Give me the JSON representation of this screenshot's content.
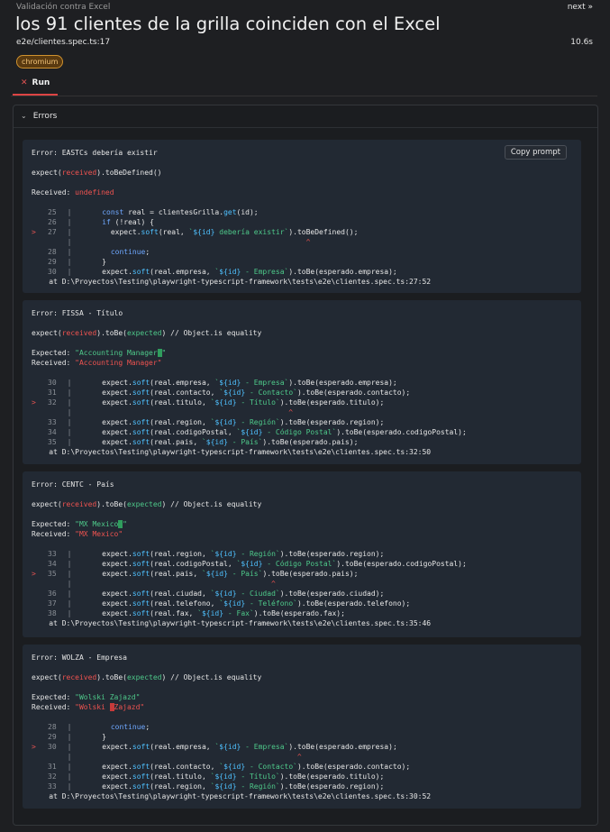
{
  "header": {
    "breadcrumb": "Validación contra Excel",
    "next": "next »",
    "title": "los 91 clientes de la grilla coinciden con el Excel",
    "file": "e2e/clientes.spec.ts:17",
    "duration": "10.6s",
    "badge": "chromium",
    "tab": "Run"
  },
  "errors_label": "Errors",
  "copy_label": "Copy prompt",
  "errors": [
    {
      "title": "Error: EASTCs debería existir",
      "assert": "expect(received).toBeDefined()",
      "received_label": "Received:",
      "received_value": "undefined",
      "lines": [
        {
          "n": "25",
          "code": "      const real = clientesGrilla.get(id);"
        },
        {
          "n": "26",
          "code": "      if (!real) {"
        },
        {
          "n": "27",
          "code": "        expect.soft(real, `${id} debería existir`).toBeDefined();",
          "current": true
        },
        {
          "n": "",
          "code": "                                                     ^"
        },
        {
          "n": "28",
          "code": "        continue;"
        },
        {
          "n": "29",
          "code": "      }"
        },
        {
          "n": "30",
          "code": "      expect.soft(real.empresa, `${id} - Empresa`).toBe(esperado.empresa);"
        }
      ],
      "at": "    at D:\\Proyectos\\Testing\\playwright-typescript-framework\\tests\\e2e\\clientes.spec.ts:27:52"
    },
    {
      "title": "Error: FISSA - Título",
      "assert": "expect(received).toBe(expected) // Object.is equality",
      "expected_label": "Expected:",
      "expected_value": "\"Accounting Manager \"",
      "received_label": "Received:",
      "received_value": "\"Accounting Manager\"",
      "lines": [
        {
          "n": "30",
          "code": "      expect.soft(real.empresa, `${id} - Empresa`).toBe(esperado.empresa);"
        },
        {
          "n": "31",
          "code": "      expect.soft(real.contacto, `${id} - Contacto`).toBe(esperado.contacto);"
        },
        {
          "n": "32",
          "code": "      expect.soft(real.titulo, `${id} - Título`).toBe(esperado.titulo);",
          "current": true
        },
        {
          "n": "",
          "code": "                                                 ^"
        },
        {
          "n": "33",
          "code": "      expect.soft(real.region, `${id} - Región`).toBe(esperado.region);"
        },
        {
          "n": "34",
          "code": "      expect.soft(real.codigoPostal, `${id} - Código Postal`).toBe(esperado.codigoPostal);"
        },
        {
          "n": "35",
          "code": "      expect.soft(real.pais, `${id} - País`).toBe(esperado.pais);"
        }
      ],
      "at": "    at D:\\Proyectos\\Testing\\playwright-typescript-framework\\tests\\e2e\\clientes.spec.ts:32:50"
    },
    {
      "title": "Error: CENTC - País",
      "assert": "expect(received).toBe(expected) // Object.is equality",
      "expected_label": "Expected:",
      "expected_value": "\"MX Mexico \"",
      "received_label": "Received:",
      "received_value": "\"MX Mexico\"",
      "lines": [
        {
          "n": "33",
          "code": "      expect.soft(real.region, `${id} - Región`).toBe(esperado.region);"
        },
        {
          "n": "34",
          "code": "      expect.soft(real.codigoPostal, `${id} - Código Postal`).toBe(esperado.codigoPostal);"
        },
        {
          "n": "35",
          "code": "      expect.soft(real.pais, `${id} - País`).toBe(esperado.pais);",
          "current": true
        },
        {
          "n": "",
          "code": "                                             ^"
        },
        {
          "n": "36",
          "code": "      expect.soft(real.ciudad, `${id} - Ciudad`).toBe(esperado.ciudad);"
        },
        {
          "n": "37",
          "code": "      expect.soft(real.telefono, `${id} - Teléfono`).toBe(esperado.telefono);"
        },
        {
          "n": "38",
          "code": "      expect.soft(real.fax, `${id} - Fax`).toBe(esperado.fax);"
        }
      ],
      "at": "    at D:\\Proyectos\\Testing\\playwright-typescript-framework\\tests\\e2e\\clientes.spec.ts:35:46"
    },
    {
      "title": "Error: WOLZA - Empresa",
      "assert": "expect(received).toBe(expected) // Object.is equality",
      "expected_label": "Expected:",
      "expected_value": "\"Wolski Zajazd\"",
      "received_label": "Received:",
      "received_value": "\"Wolski  Zajazd\"",
      "lines": [
        {
          "n": "28",
          "code": "        continue;"
        },
        {
          "n": "29",
          "code": "      }"
        },
        {
          "n": "30",
          "code": "      expect.soft(real.empresa, `${id} - Empresa`).toBe(esperado.empresa);",
          "current": true
        },
        {
          "n": "",
          "code": "                                                   ^"
        },
        {
          "n": "31",
          "code": "      expect.soft(real.contacto, `${id} - Contacto`).toBe(esperado.contacto);"
        },
        {
          "n": "32",
          "code": "      expect.soft(real.titulo, `${id} - Título`).toBe(esperado.titulo);"
        },
        {
          "n": "33",
          "code": "      expect.soft(real.region, `${id} - Región`).toBe(esperado.region);"
        }
      ],
      "at": "    at D:\\Proyectos\\Testing\\playwright-typescript-framework\\tests\\e2e\\clientes.spec.ts:30:52"
    }
  ]
}
